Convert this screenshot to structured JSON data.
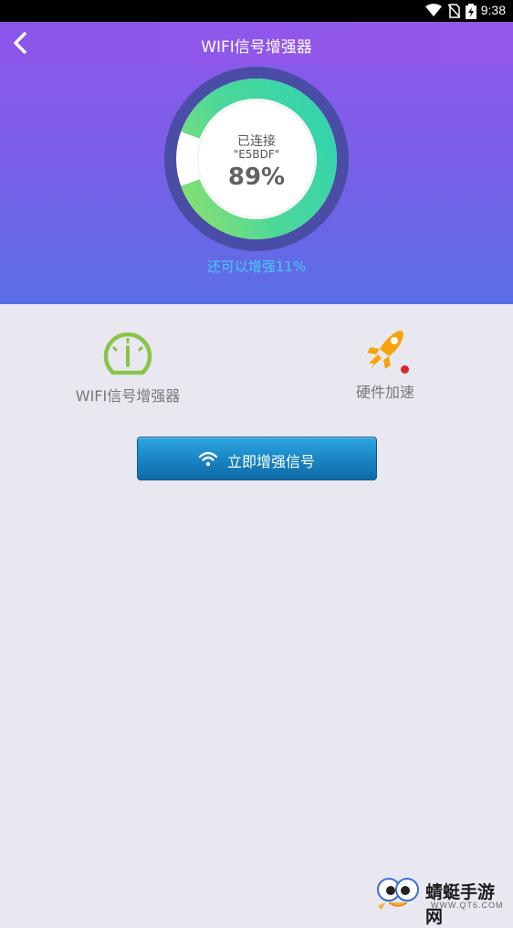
{
  "status_bar": {
    "time": "9:38",
    "icons": [
      "wifi-icon",
      "no-sim-icon",
      "battery-icon"
    ]
  },
  "header": {
    "title": "WIFI信号增强器",
    "back_icon": "back-arrow-icon"
  },
  "gauge": {
    "status": "已连接",
    "ssid": "\"E5BDF\"",
    "percent_label": "89%",
    "percent_value": 89,
    "ring_colors": [
      "#35d6a8",
      "#8fe06a"
    ],
    "outer_ring_color": "#4b4ea8"
  },
  "boost_hint": "还可以增强11%",
  "features": [
    {
      "label": "WIFI信号增强器",
      "icon": "speedometer-icon",
      "color": "#8bc34a"
    },
    {
      "label": "硬件加速",
      "icon": "rocket-icon",
      "color": "#f5a40c",
      "badge": true
    }
  ],
  "primary_button": {
    "label": "立即增强信号",
    "icon": "wifi-icon"
  },
  "watermark": {
    "name": "蜻蜓手游网",
    "url": "WWW.QT6.COM"
  },
  "colors": {
    "accent": "#45c9f4",
    "header": "#8f57ec",
    "button": "#1a86c4"
  }
}
